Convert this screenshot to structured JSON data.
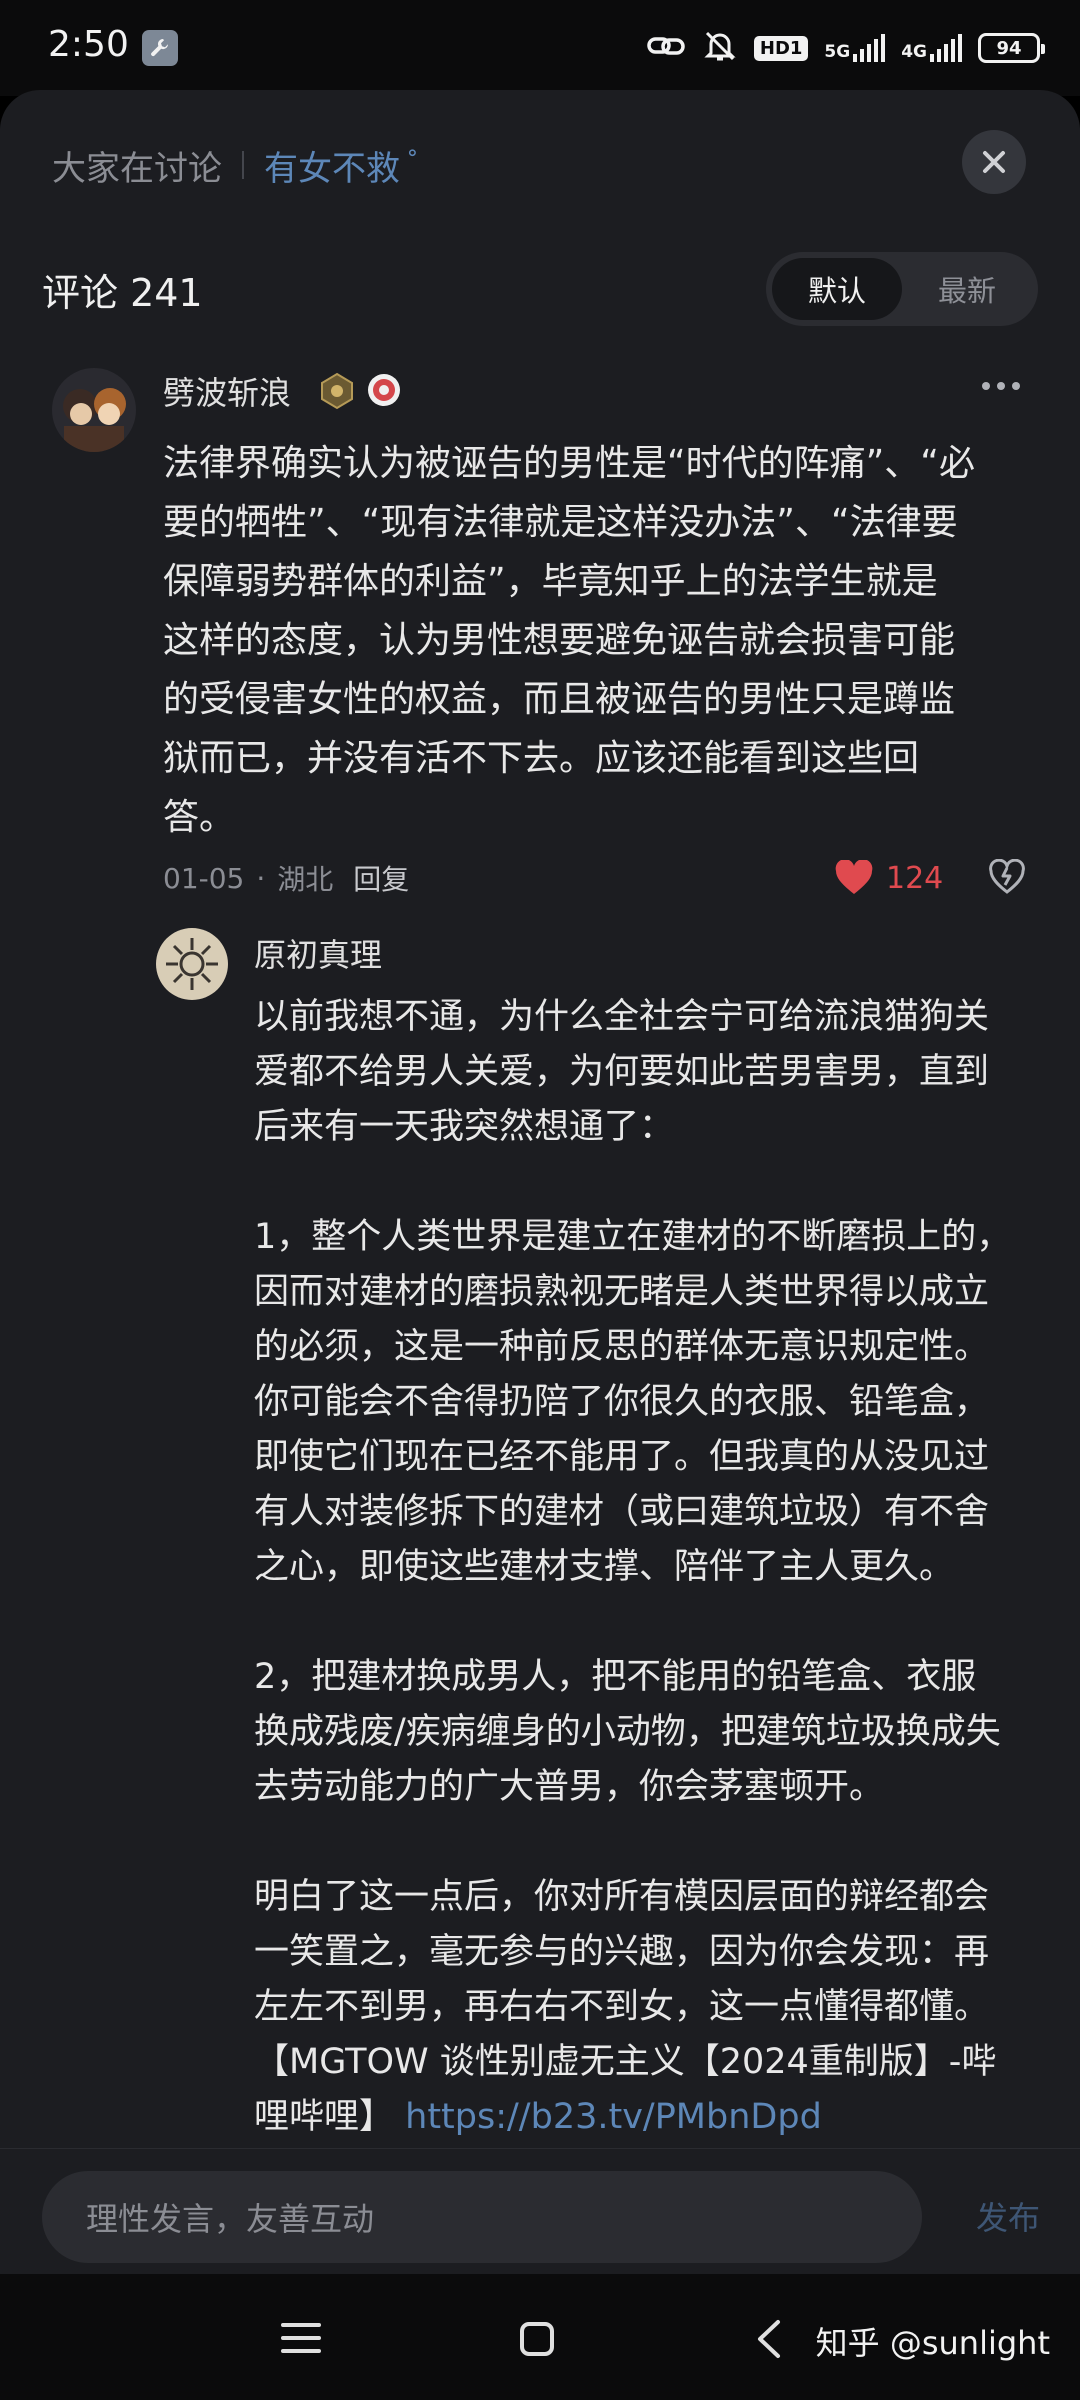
{
  "status_bar": {
    "time": "2:50",
    "hd_label": "HD1",
    "net_5g": "5G",
    "net_4g": "4G",
    "battery": "94"
  },
  "header": {
    "discuss_label": "大家在讨论",
    "discuss_topic": "有女不救",
    "comments_title": "评论 241",
    "sort_options": [
      "默认",
      "最新"
    ],
    "sort_selected": "默认"
  },
  "comment": {
    "username": "劈波斩浪",
    "text": "法律界确实认为被诬告的男性是“时代的阵痛”、“必\n要的牺牲”、“现有法律就是这样没办法”、“法律要\n保障弱势群体的利益”，毕竟知乎上的法学生就是\n这样的态度，认为男性想要避免诬告就会损害可能\n的受侵害女性的权益，而且被诬告的男性只是蹲监\n狱而已，并没有活不下去。应该还能看到这些回\n答。",
    "date": "01-05",
    "location": "湖北",
    "reply_label": "回复",
    "like_count": "124"
  },
  "reply": {
    "username": "原初真理",
    "text": "以前我想不通，为什么全社会宁可给流浪猫狗关\n爱都不给男人关爱，为何要如此苦男害男，直到\n后来有一天我突然想通了：\n\n1，整个人类世界是建立在建材的不断磨损上的，\n因而对建材的磨损熟视无睹是人类世界得以成立\n的必须，这是一种前反思的群体无意识规定性。\n你可能会不舍得扔陪了你很久的衣服、铅笔盒，\n即使它们现在已经不能用了。但我真的从没见过\n有人对装修拆下的建材（或曰建筑垃圾）有不舍\n之心，即使这些建材支撑、陪伴了主人更久。\n\n2，把建材换成男人，把不能用的铅笔盒、衣服\n换成残废/疾病缠身的小动物，把建筑垃圾换成失\n去劳动能力的广大普男，你会茅塞顿开。\n\n明白了这一点后，你对所有模因层面的辩经都会\n一笑置之，毫无参与的兴趣，因为你会发现：再\n左左不到男，再右右不到女，这一点懂得都懂。\n【MGTOW 谈性别虚无主义【2024重制版】-哔\n哩哔哩】 ",
    "link": "https://b23.tv/PMbnDpd"
  },
  "input": {
    "placeholder": "理性发言，友善互动",
    "send_label": "发布"
  },
  "watermark": "知乎 @sunlight",
  "colors": {
    "accent_link": "#5d87b8",
    "like_red": "#e04a4f",
    "background": "#1c1d21"
  }
}
